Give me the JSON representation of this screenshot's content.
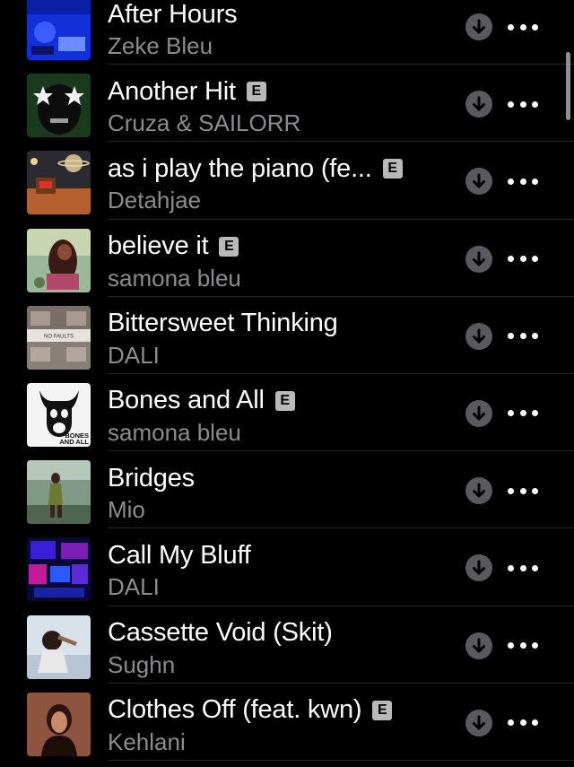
{
  "songs": [
    {
      "title": "After Hours",
      "artist": "Zeke Bleu",
      "explicit": false,
      "art": "after-hours"
    },
    {
      "title": "Another Hit",
      "artist": "Cruza & SAILORR",
      "explicit": true,
      "art": "another-hit"
    },
    {
      "title": "as i play the piano (fe...",
      "artist": "Detahjae",
      "explicit": true,
      "art": "piano"
    },
    {
      "title": "believe it",
      "artist": "samona bleu",
      "explicit": true,
      "art": "believe-it"
    },
    {
      "title": "Bittersweet Thinking",
      "artist": "DALI",
      "explicit": false,
      "art": "bittersweet"
    },
    {
      "title": "Bones and All",
      "artist": "samona bleu",
      "explicit": true,
      "art": "bones"
    },
    {
      "title": "Bridges",
      "artist": "Mio",
      "explicit": false,
      "art": "bridges"
    },
    {
      "title": "Call My Bluff",
      "artist": "DALI",
      "explicit": false,
      "art": "call-my-bluff"
    },
    {
      "title": "Cassette Void (Skit)",
      "artist": "Sughn",
      "explicit": false,
      "art": "cassette-void"
    },
    {
      "title": "Clothes Off (feat. kwn)",
      "artist": "Kehlani",
      "explicit": true,
      "art": "clothes-off"
    }
  ],
  "explicit_badge": "E",
  "art_text": {
    "no_faults": "NO FAULTS",
    "bones_line1": "BONES",
    "bones_line2": "AND ALL"
  },
  "icons": {
    "download": "download-arrow-icon",
    "more": "ellipsis-icon"
  },
  "colors": {
    "background": "#000000",
    "title": "#ffffff",
    "subtitle": "#8c8c8f",
    "badge": "#b9b9b9",
    "download_circle": "#5a5a5e"
  }
}
